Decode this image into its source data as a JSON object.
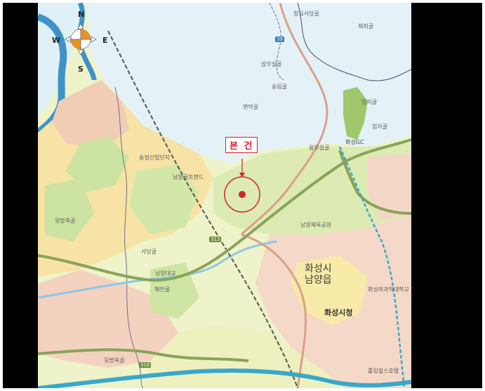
{
  "site_marker": {
    "label": "본 건",
    "color": "#d3242c"
  },
  "compass": {
    "north": "N",
    "south": "S",
    "east": "E",
    "west": "W",
    "accent": "#e8921e"
  },
  "city_labels": {
    "line1": "화성시",
    "line2": "남양읍",
    "city_hall": "화성시청"
  },
  "places": [
    "청요사당골",
    "제피골",
    "삼부실골",
    "송림골",
    "맨막골",
    "엄지골",
    "엄자골",
    "용부실골",
    "화성GC",
    "송정산업단지",
    "남양골프랜드",
    "뒷방축골",
    "남양체육공원",
    "사당골",
    "남양대교",
    "해안골",
    "화성의과학대학교",
    "뒷방축골",
    "롤링힐스호텔"
  ],
  "roads": {
    "route_313": "313",
    "route_39": "39",
    "route_318": "318"
  },
  "colors": {
    "water": "#dff1f7",
    "river": "#5aa9d6",
    "forest": "#cde3a1",
    "urban": "#f6d4c2",
    "farmland": "#f7f3a8",
    "main_road": "#8aa35a",
    "highway": "#39a7c9",
    "local_road": "#d9a088"
  }
}
